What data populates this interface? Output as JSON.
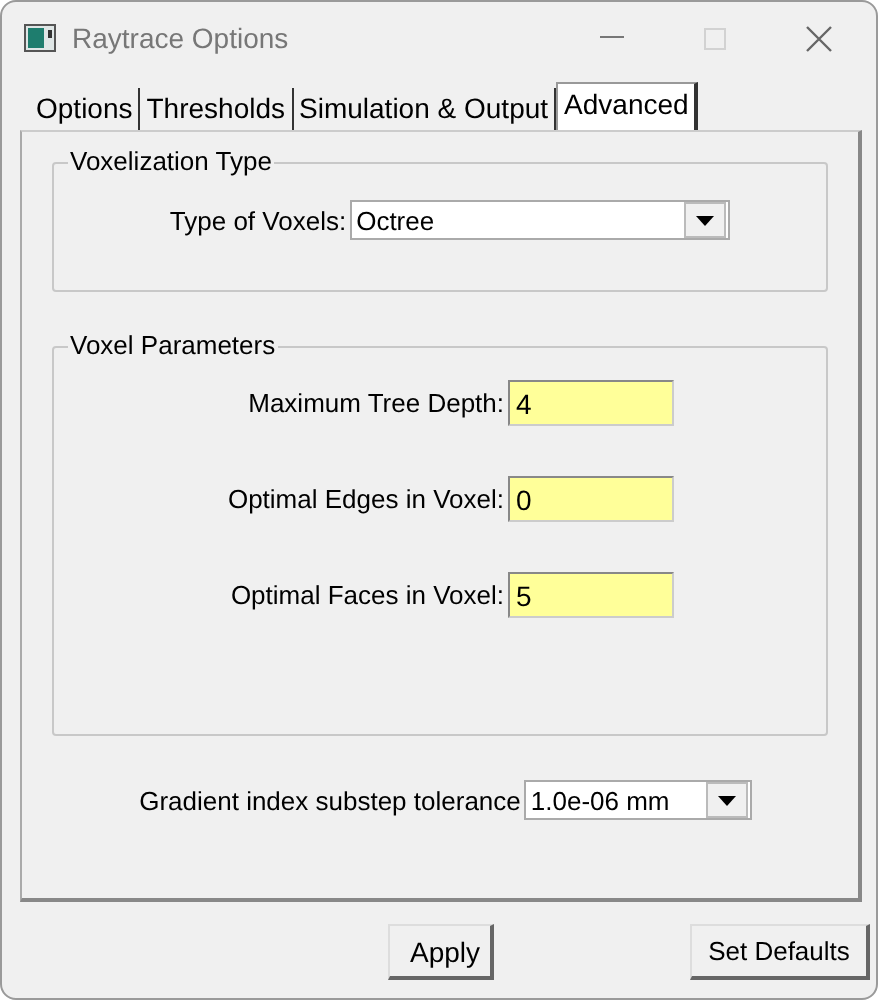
{
  "window": {
    "title": "Raytrace Options"
  },
  "tabs": [
    {
      "label": "Options",
      "selected": false
    },
    {
      "label": "Thresholds",
      "selected": false
    },
    {
      "label": "Simulation & Output",
      "selected": false
    },
    {
      "label": "Advanced",
      "selected": true
    }
  ],
  "voxelization_type": {
    "title": "Voxelization Type",
    "label": "Type of Voxels:",
    "value": "Octree"
  },
  "voxel_parameters": {
    "title": "Voxel Parameters",
    "fields": [
      {
        "label": "Maximum Tree Depth:",
        "value": "4"
      },
      {
        "label": "Optimal Edges in Voxel:",
        "value": "0"
      },
      {
        "label": "Optimal Faces in Voxel:",
        "value": "5"
      }
    ]
  },
  "gradient": {
    "label": "Gradient index substep tolerance",
    "value": "1.0e-06 mm"
  },
  "buttons": [
    "Apply",
    "Set Defaults"
  ]
}
